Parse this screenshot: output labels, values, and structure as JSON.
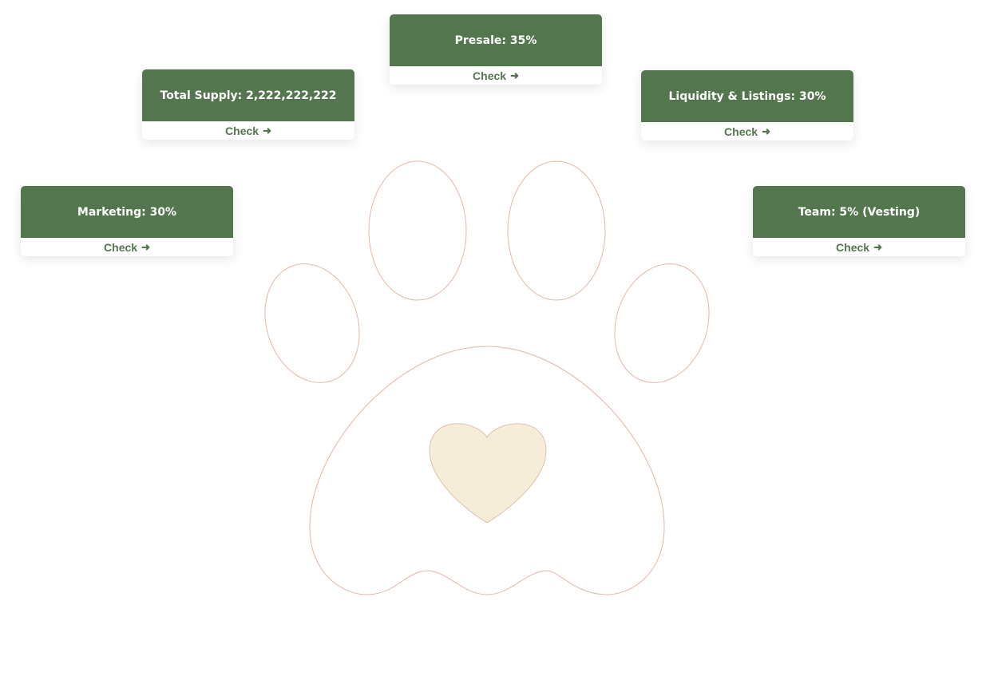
{
  "colors": {
    "card_header": "#54764e",
    "paw_outline": "#e2b8a6",
    "heart_fill": "#f5ecd9"
  },
  "cards": [
    {
      "label": "Marketing: 30%",
      "link": "Check",
      "icon": "arrow-right-icon"
    },
    {
      "label": "Total Supply: 2,222,222,222",
      "link": "Check",
      "icon": "arrow-right-icon"
    },
    {
      "label": "Presale: 35%",
      "link": "Check",
      "icon": "arrow-right-icon"
    },
    {
      "label": "Liquidity & Listings: 30%",
      "link": "Check",
      "icon": "arrow-right-icon"
    },
    {
      "label": "Team: 5% (Vesting)",
      "link": "Check",
      "icon": "arrow-right-icon"
    }
  ],
  "arrow_glyph": "➜"
}
